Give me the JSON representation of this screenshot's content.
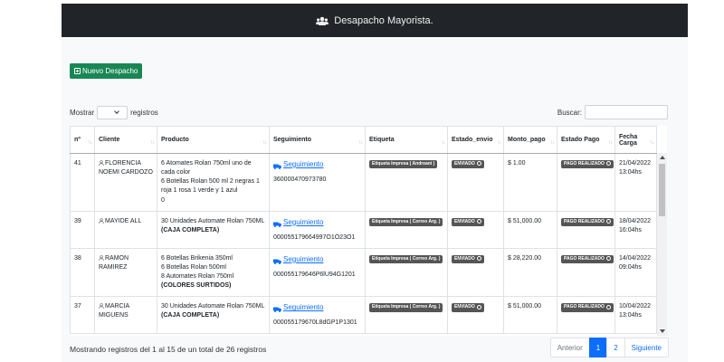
{
  "header": {
    "title": "Desapacho Mayorista."
  },
  "toolbar": {
    "new_label": "Nuevo Despacho"
  },
  "length": {
    "prefix": "Mostrar",
    "suffix": "registros"
  },
  "search": {
    "label": "Buscar:",
    "value": ""
  },
  "table": {
    "columns": [
      "nº",
      "Cliente",
      "Producto",
      "Seguimiento",
      "Etiqueta",
      "Estado_envio",
      "Monto_pago",
      "Estado Pago",
      "Fecha Carga"
    ],
    "rows": [
      {
        "num": "41",
        "client": "FLORENCIA NOEMI CARDOZO",
        "product_lines": [
          "6 Atomates Rolan 750ml uno de cada color",
          "6 Botellas Rolan 500 ml 2 negras 1 roja 1 rosa 1 verde y 1 azul",
          "0"
        ],
        "product_bold": "",
        "tracking_label": "Seguimiento",
        "tracking_code": "360000470973780",
        "label_badge": "Etiqueta Impresa ( Andreani )",
        "ship_status": "ENVIADO",
        "amount": "$ 1.00",
        "pay_status": "PAGO REALIZADO",
        "date": "21/04/2022",
        "time": "13:04hs"
      },
      {
        "num": "39",
        "client": "MAYIDE ALL",
        "product_lines": [
          "30 Unidades Automate Rolan 750ML"
        ],
        "product_bold": "(CAJA COMPLETA)",
        "tracking_label": "Seguimiento",
        "tracking_code": "000055179664997O1O23O1",
        "label_badge": "Etiqueta Impresa ( Correo Arg. )",
        "ship_status": "ENVIADO",
        "amount": "$ 51,000.00",
        "pay_status": "PAGO REALIZADO",
        "date": "18/04/2022",
        "time": "16:04hs"
      },
      {
        "num": "38",
        "client": "RAMON RAMIREZ",
        "product_lines": [
          "6 Botellas Brikenia 350ml",
          "6 Botellas Rolan 500ml",
          "8 Automates Rolan 750ml"
        ],
        "product_bold": "(COLORES SURTIDOS)",
        "tracking_label": "Seguimiento",
        "tracking_code": "000055179646P6lU94G1201",
        "label_badge": "Etiqueta Impresa ( Correo Arg. )",
        "ship_status": "ENVIADO",
        "amount": "$ 28,220.00",
        "pay_status": "PAGO REALIZADO",
        "date": "14/04/2022",
        "time": "09:04hs"
      },
      {
        "num": "37",
        "client": "MARCIA MIGUENS",
        "product_lines": [
          "30 Unidades Automate Rolan 750ML"
        ],
        "product_bold": "(CAJA COMPLETA)",
        "tracking_label": "Seguimiento",
        "tracking_code": "000055179670L8dGP1P1301",
        "label_badge": "Etiqueta Impresa ( Correo Arg. )",
        "ship_status": "ENVIADO",
        "amount": "$ 51,000.00",
        "pay_status": "PAGO REALIZADO",
        "date": "10/04/2022",
        "time": "13:04hs"
      }
    ]
  },
  "footer": {
    "info": "Mostrando registros del 1 al 15 de un total de 26 registros",
    "prev": "Anterior",
    "pages": [
      "1",
      "2"
    ],
    "next": "Siguiente"
  },
  "colors": {
    "topbar": "#212529",
    "new_button": "#198754",
    "link": "#0d6efd",
    "badge": "#6c757d"
  }
}
